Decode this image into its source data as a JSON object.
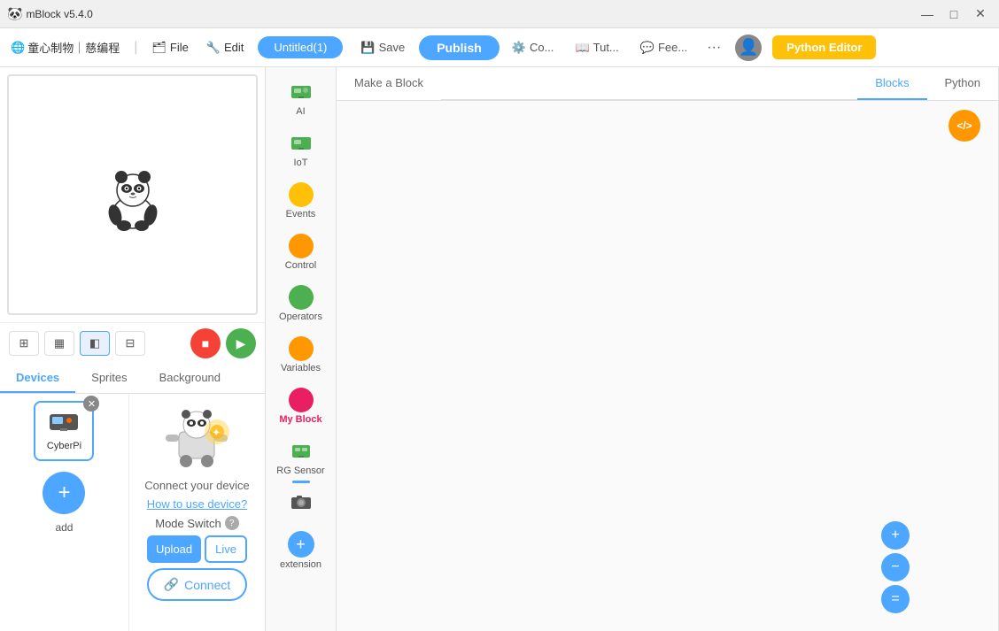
{
  "titlebar": {
    "title": "mBlock v5.4.0",
    "icon": "🐼",
    "minimize_label": "—",
    "maximize_label": "□",
    "close_label": "✕"
  },
  "menubar": {
    "brand_text": "童心制物｜慈编程",
    "globe_icon": "🌐",
    "file_label": "File",
    "edit_label": "Edit",
    "project_name": "Untitled(1)",
    "save_label": "Save",
    "publish_label": "Publish",
    "co_label": "Co...",
    "tut_label": "Tut...",
    "fee_label": "Fee...",
    "more_label": "···",
    "python_editor_label": "Python Editor"
  },
  "tabs": {
    "devices_label": "Devices",
    "sprites_label": "Sprites",
    "background_label": "Background"
  },
  "device": {
    "name": "CyberPi",
    "connect_text": "Connect your device",
    "how_to_label": "How to use device?",
    "mode_switch_label": "Mode Switch",
    "upload_label": "Upload",
    "live_label": "Live",
    "connect_label": "Connect",
    "add_label": "add"
  },
  "palette": {
    "items": [
      {
        "id": "ai",
        "label": "AI",
        "color": "#4caf50",
        "type": "icon",
        "icon": "🤖"
      },
      {
        "id": "iot",
        "label": "IoT",
        "color": "#4caf50",
        "type": "icon",
        "icon": "📡"
      },
      {
        "id": "events",
        "label": "Events",
        "color": "#ffc107",
        "type": "dot"
      },
      {
        "id": "control",
        "label": "Control",
        "color": "#ff9800",
        "type": "dot"
      },
      {
        "id": "operators",
        "label": "Operators",
        "color": "#4caf50",
        "type": "dot"
      },
      {
        "id": "variables",
        "label": "Variables",
        "color": "#ff9800",
        "type": "dot"
      },
      {
        "id": "myblock",
        "label": "My Block",
        "color": "#e91e63",
        "type": "dot",
        "active": true
      },
      {
        "id": "rgsensor",
        "label": "RG Sensor",
        "color": "#4caf50",
        "type": "icon",
        "icon": "🔌"
      },
      {
        "id": "camera",
        "label": "",
        "color": "",
        "type": "icon",
        "icon": "📷"
      },
      {
        "id": "extension",
        "label": "extension",
        "color": "#4da6ff",
        "type": "plus"
      }
    ]
  },
  "workspace": {
    "make_block_label": "Make a Block",
    "blocks_tab": "Blocks",
    "python_tab": "Python"
  },
  "zoom": {
    "in_label": "+",
    "out_label": "−",
    "reset_label": "="
  },
  "code_icon": "</>",
  "colors": {
    "primary": "#4da6ff",
    "accent": "#ffc107",
    "stop": "#f44336",
    "play": "#4caf50",
    "myblock": "#e91e63"
  }
}
